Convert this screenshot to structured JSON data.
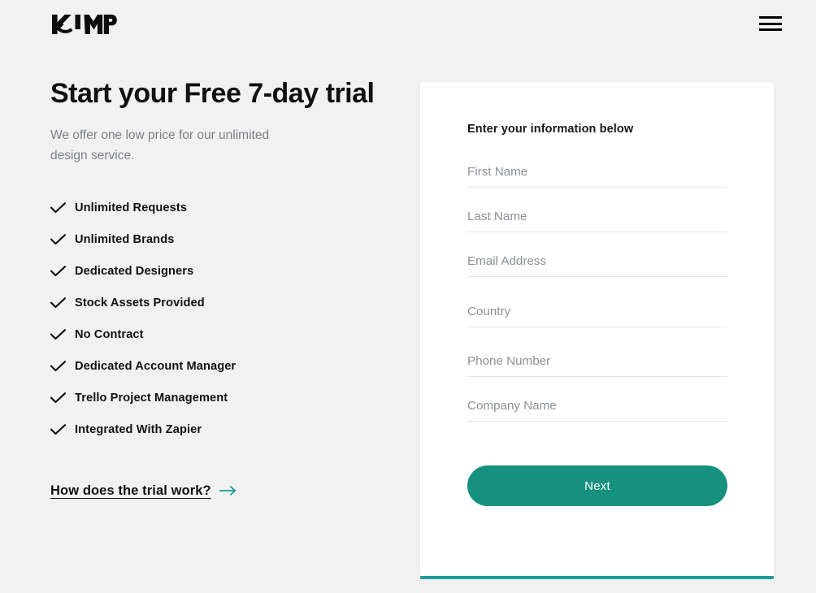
{
  "header": {
    "logo_text": "KIMP",
    "logo_icon": "kimp-logo",
    "menu_icon": "hamburger-menu-icon"
  },
  "hero": {
    "title": "Start your Free 7-day trial",
    "subtitle": "We offer one low price for our unlimited design service."
  },
  "features": [
    {
      "label": "Unlimited Requests",
      "icon": "check-icon"
    },
    {
      "label": "Unlimited Brands",
      "icon": "check-icon"
    },
    {
      "label": "Dedicated Designers",
      "icon": "check-icon"
    },
    {
      "label": "Stock Assets Provided",
      "icon": "check-icon"
    },
    {
      "label": "No Contract",
      "icon": "check-icon"
    },
    {
      "label": "Dedicated Account Manager",
      "icon": "check-icon"
    },
    {
      "label": "Trello Project Management",
      "icon": "check-icon"
    },
    {
      "label": "Integrated With Zapier",
      "icon": "check-icon"
    }
  ],
  "trial_link": {
    "label": "How does the trial work?",
    "icon": "arrow-right-icon"
  },
  "form": {
    "heading": "Enter your information below",
    "fields": [
      {
        "name": "first-name",
        "placeholder": "First Name",
        "value": ""
      },
      {
        "name": "last-name",
        "placeholder": "Last Name",
        "value": ""
      },
      {
        "name": "email-address",
        "placeholder": "Email Address",
        "value": ""
      },
      {
        "name": "country",
        "placeholder": "Country",
        "value": ""
      },
      {
        "name": "phone-number",
        "placeholder": "Phone Number",
        "value": ""
      },
      {
        "name": "company-name",
        "placeholder": "Company Name",
        "value": ""
      }
    ],
    "submit_label": "Next"
  },
  "colors": {
    "background": "#f1f1f1",
    "accent_teal": "#17917f",
    "progress_teal": "#23999a",
    "text_dark": "#111111",
    "text_muted": "#7b7f86",
    "placeholder": "#8b9096"
  }
}
